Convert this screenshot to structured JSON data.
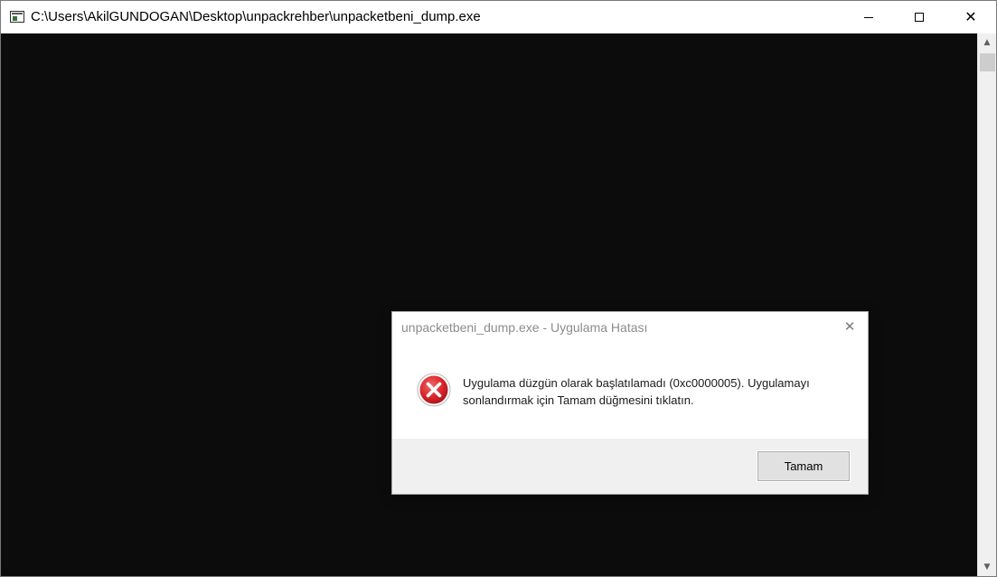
{
  "window": {
    "title": "C:\\Users\\AkilGUNDOGAN\\Desktop\\unpackrehber\\unpacketbeni_dump.exe",
    "icon": "console-app-icon",
    "minimize_glyph": "",
    "close_glyph": "✕"
  },
  "scrollbar": {
    "up_arrow": "▲",
    "down_arrow": "▼"
  },
  "dialog": {
    "title": "unpacketbeni_dump.exe - Uygulama Hatası",
    "close_glyph": "✕",
    "icon": "error-icon",
    "message": "Uygulama düzgün olarak başlatılamadı (0xc0000005). Uygulamayı sonlandırmak için Tamam düğmesini tıklatın.",
    "ok_label": "Tamam"
  },
  "colors": {
    "console_background": "#0c0c0c",
    "error_red": "#d9262c",
    "dialog_footer": "#f0f0f0"
  }
}
